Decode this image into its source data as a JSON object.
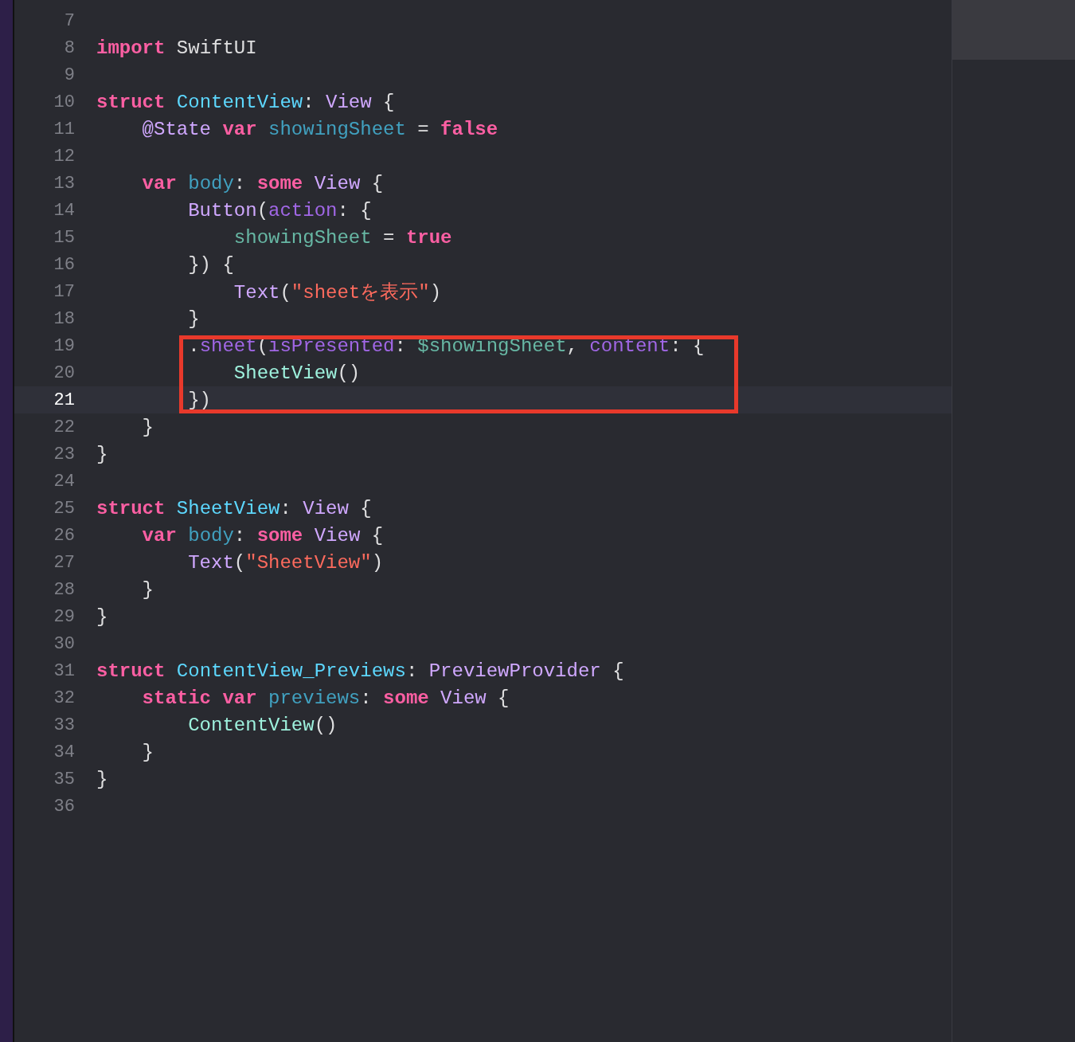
{
  "editor": {
    "lines": [
      {
        "number": "7",
        "current": false,
        "boxed": false
      },
      {
        "number": "8",
        "current": false,
        "boxed": false,
        "tokens": [
          {
            "text": "import",
            "kind": "keyword"
          },
          {
            "text": " SwiftUI",
            "kind": "plain"
          }
        ]
      },
      {
        "number": "9",
        "current": false,
        "boxed": false
      },
      {
        "number": "10",
        "current": false,
        "boxed": false,
        "tokens": [
          {
            "text": "struct",
            "kind": "keyword"
          },
          {
            "text": " ContentView",
            "kind": "decl-type"
          },
          {
            "text": ": ",
            "kind": "plain"
          },
          {
            "text": "View",
            "kind": "type"
          },
          {
            "text": " {",
            "kind": "plain"
          }
        ]
      },
      {
        "number": "11",
        "current": false,
        "boxed": false,
        "tokens": [
          {
            "text": "    @State",
            "kind": "type"
          },
          {
            "text": " var",
            "kind": "keyword"
          },
          {
            "text": " showingSheet",
            "kind": "decl"
          },
          {
            "text": " = ",
            "kind": "plain"
          },
          {
            "text": "false",
            "kind": "keyword"
          }
        ]
      },
      {
        "number": "12",
        "current": false,
        "boxed": false
      },
      {
        "number": "13",
        "current": false,
        "boxed": false,
        "tokens": [
          {
            "text": "    var",
            "kind": "keyword"
          },
          {
            "text": " body",
            "kind": "decl"
          },
          {
            "text": ": ",
            "kind": "plain"
          },
          {
            "text": "some",
            "kind": "keyword"
          },
          {
            "text": " View",
            "kind": "type"
          },
          {
            "text": " {",
            "kind": "plain"
          }
        ]
      },
      {
        "number": "14",
        "current": false,
        "boxed": false,
        "tokens": [
          {
            "text": "        Button",
            "kind": "type"
          },
          {
            "text": "(",
            "kind": "plain"
          },
          {
            "text": "action",
            "kind": "member"
          },
          {
            "text": ": {",
            "kind": "plain"
          }
        ]
      },
      {
        "number": "15",
        "current": false,
        "boxed": false,
        "tokens": [
          {
            "text": "            showingSheet",
            "kind": "ref"
          },
          {
            "text": " = ",
            "kind": "plain"
          },
          {
            "text": "true",
            "kind": "keyword"
          }
        ]
      },
      {
        "number": "16",
        "current": false,
        "boxed": false,
        "tokens": [
          {
            "text": "        }) {",
            "kind": "plain"
          }
        ]
      },
      {
        "number": "17",
        "current": false,
        "boxed": false,
        "tokens": [
          {
            "text": "            Text",
            "kind": "type"
          },
          {
            "text": "(",
            "kind": "plain"
          },
          {
            "text": "\"sheetを表示\"",
            "kind": "string"
          },
          {
            "text": ")",
            "kind": "plain"
          }
        ]
      },
      {
        "number": "18",
        "current": false,
        "boxed": false,
        "tokens": [
          {
            "text": "        }",
            "kind": "plain"
          }
        ]
      },
      {
        "number": "19",
        "current": false,
        "boxed": true,
        "tokens": [
          {
            "text": "        .",
            "kind": "plain"
          },
          {
            "text": "sheet",
            "kind": "member"
          },
          {
            "text": "(",
            "kind": "plain"
          },
          {
            "text": "isPresented",
            "kind": "member"
          },
          {
            "text": ": ",
            "kind": "plain"
          },
          {
            "text": "$showingSheet",
            "kind": "ref"
          },
          {
            "text": ", ",
            "kind": "plain"
          },
          {
            "text": "content",
            "kind": "member"
          },
          {
            "text": ": {",
            "kind": "plain"
          }
        ]
      },
      {
        "number": "20",
        "current": false,
        "boxed": true,
        "tokens": [
          {
            "text": "            SheetView",
            "kind": "class-ref"
          },
          {
            "text": "()",
            "kind": "plain"
          }
        ]
      },
      {
        "number": "21",
        "current": true,
        "boxed": true,
        "tokens": [
          {
            "text": "        })",
            "kind": "plain"
          }
        ]
      },
      {
        "number": "22",
        "current": false,
        "boxed": false,
        "tokens": [
          {
            "text": "    }",
            "kind": "plain"
          }
        ]
      },
      {
        "number": "23",
        "current": false,
        "boxed": false,
        "tokens": [
          {
            "text": "}",
            "kind": "plain"
          }
        ]
      },
      {
        "number": "24",
        "current": false,
        "boxed": false
      },
      {
        "number": "25",
        "current": false,
        "boxed": false,
        "tokens": [
          {
            "text": "struct",
            "kind": "keyword"
          },
          {
            "text": " SheetView",
            "kind": "decl-type"
          },
          {
            "text": ": ",
            "kind": "plain"
          },
          {
            "text": "View",
            "kind": "type"
          },
          {
            "text": " {",
            "kind": "plain"
          }
        ]
      },
      {
        "number": "26",
        "current": false,
        "boxed": false,
        "tokens": [
          {
            "text": "    var",
            "kind": "keyword"
          },
          {
            "text": " body",
            "kind": "decl"
          },
          {
            "text": ": ",
            "kind": "plain"
          },
          {
            "text": "some",
            "kind": "keyword"
          },
          {
            "text": " View",
            "kind": "type"
          },
          {
            "text": " {",
            "kind": "plain"
          }
        ]
      },
      {
        "number": "27",
        "current": false,
        "boxed": false,
        "tokens": [
          {
            "text": "        Text",
            "kind": "type"
          },
          {
            "text": "(",
            "kind": "plain"
          },
          {
            "text": "\"SheetView\"",
            "kind": "string"
          },
          {
            "text": ")",
            "kind": "plain"
          }
        ]
      },
      {
        "number": "28",
        "current": false,
        "boxed": false,
        "tokens": [
          {
            "text": "    }",
            "kind": "plain"
          }
        ]
      },
      {
        "number": "29",
        "current": false,
        "boxed": false,
        "tokens": [
          {
            "text": "}",
            "kind": "plain"
          }
        ]
      },
      {
        "number": "30",
        "current": false,
        "boxed": false
      },
      {
        "number": "31",
        "current": false,
        "boxed": false,
        "tokens": [
          {
            "text": "struct",
            "kind": "keyword"
          },
          {
            "text": " ContentView_Previews",
            "kind": "decl-type"
          },
          {
            "text": ": ",
            "kind": "plain"
          },
          {
            "text": "PreviewProvider",
            "kind": "type"
          },
          {
            "text": " {",
            "kind": "plain"
          }
        ]
      },
      {
        "number": "32",
        "current": false,
        "boxed": false,
        "tokens": [
          {
            "text": "    static",
            "kind": "keyword"
          },
          {
            "text": " var",
            "kind": "keyword"
          },
          {
            "text": " previews",
            "kind": "decl"
          },
          {
            "text": ": ",
            "kind": "plain"
          },
          {
            "text": "some",
            "kind": "keyword"
          },
          {
            "text": " View",
            "kind": "type"
          },
          {
            "text": " {",
            "kind": "plain"
          }
        ]
      },
      {
        "number": "33",
        "current": false,
        "boxed": false,
        "tokens": [
          {
            "text": "        ContentView",
            "kind": "class-ref"
          },
          {
            "text": "()",
            "kind": "plain"
          }
        ]
      },
      {
        "number": "34",
        "current": false,
        "boxed": false,
        "tokens": [
          {
            "text": "    }",
            "kind": "plain"
          }
        ]
      },
      {
        "number": "35",
        "current": false,
        "boxed": false,
        "tokens": [
          {
            "text": "}",
            "kind": "plain"
          }
        ]
      },
      {
        "number": "36",
        "current": false,
        "boxed": false
      }
    ]
  }
}
